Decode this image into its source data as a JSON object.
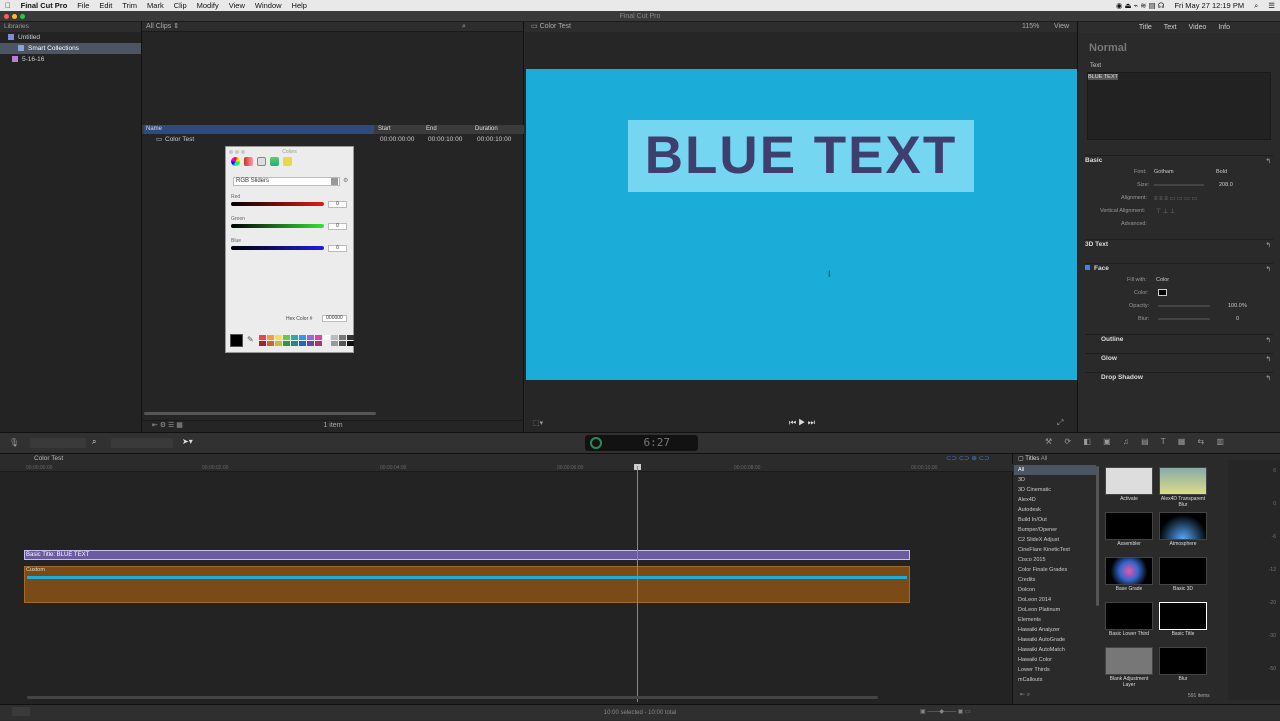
{
  "menubar": {
    "app": "Final Cut Pro",
    "items": [
      "File",
      "Edit",
      "Trim",
      "Mark",
      "Clip",
      "Modify",
      "View",
      "Window",
      "Help"
    ],
    "clock": "Fri May 27  12:19 PM"
  },
  "window": {
    "title": "Final Cut Pro"
  },
  "libraries": {
    "header": "Libraries",
    "items": [
      {
        "label": "Untitled"
      },
      {
        "label": "Smart Collections"
      },
      {
        "label": "5-16-16"
      }
    ]
  },
  "browser": {
    "filter": "All Clips",
    "columns": [
      "Name",
      "Start",
      "End",
      "Duration"
    ],
    "row": {
      "name": "Color Test",
      "start": "00:00:00:00",
      "end": "00:00:10:00",
      "duration": "00:00:10:00"
    },
    "count": "1 item"
  },
  "colors_panel": {
    "title": "Colors",
    "mode": "RGB Sliders",
    "sliders": [
      {
        "label": "Red",
        "value": "0",
        "color": "#c41e1e"
      },
      {
        "label": "Green",
        "value": "0",
        "color": "#3cc43c"
      },
      {
        "label": "Blue",
        "value": "0",
        "color": "#2020c8"
      }
    ],
    "hex_label": "Hex Color #",
    "hex_value": "000000"
  },
  "viewer": {
    "title": "Color Test",
    "zoom": "115%",
    "view": "View",
    "canvas_text": "BLUE TEXT",
    "bg_color": "#1badd8"
  },
  "inspector": {
    "tabs": [
      "Title",
      "Text",
      "Video",
      "Info"
    ],
    "preset": "Normal",
    "text_label": "Text",
    "text_value": "BLUE TEXT",
    "basic": "Basic",
    "font_label": "Font:",
    "font_value": "Gotham",
    "weight": "Bold",
    "size_label": "Size:",
    "size_value": "208.0",
    "alignment_label": "Alignment:",
    "valign_label": "Vertical Alignment:",
    "advanced": "Advanced:",
    "s3d": "3D Text",
    "face": "Face",
    "fill_label": "Fill with:",
    "fill_value": "Color",
    "color_label": "Color:",
    "opacity_label": "Opacity:",
    "opacity_value": "100.0",
    "opacity_unit": "%",
    "blur_label": "Blur:",
    "blur_value": "0",
    "outline": "Outline",
    "glow": "Glow",
    "shadow": "Drop Shadow"
  },
  "timecode": "6:27",
  "timeline": {
    "title": "Color Test",
    "ruler": [
      "00:00:00:00",
      "00:00:02:00",
      "00:00:04:00",
      "00:00:06:00",
      "00:00:08:00",
      "00:00:10:00"
    ],
    "title_clip": "Basic Title: BLUE TEXT",
    "main_clip": "Custom"
  },
  "titles_browser": {
    "header": "Titles",
    "all": "All",
    "categories": [
      "All",
      "3D",
      "3D Cinematic",
      "Alex4D",
      "Autodesk",
      "Build In/Out",
      "Bumper/Opener",
      "C2 SlideX Adjust",
      "CineFlare KineticText",
      "Cisco 2015",
      "Color Finale Grades",
      "Credits",
      "Dolcon",
      "DoLeon 2014",
      "DoLeon Platinum",
      "Elements",
      "Hawaiki Analyzer",
      "Hawaiki AutoGrade",
      "Hawaiki AutoMatch",
      "Hawaiki Color",
      "Lower Thirds",
      "mCallouts"
    ],
    "thumbs": [
      "Activate",
      "Alex4D Transparent Blur",
      "Assembler",
      "Atmosphere",
      "Base Grade",
      "Basic 3D",
      "Basic Lower Third",
      "Basic Title",
      "Blank Adjustment Layer",
      "Blur"
    ],
    "count": "591 items"
  },
  "meters": [
    "6",
    "0",
    "-6",
    "-12",
    "-20",
    "-30",
    "-50"
  ],
  "status": "10:00 selected - 10:00 total"
}
